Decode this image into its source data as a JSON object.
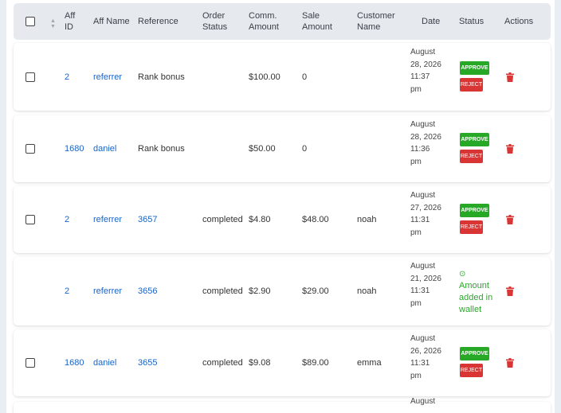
{
  "header": {
    "aff_id": "Aff\nID",
    "aff_name": "Aff Name",
    "reference": "Reference",
    "order_status": "Order\nStatus",
    "comm_amount": "Comm.\nAmount",
    "sale_amount": "Sale\nAmount",
    "customer_name": "Customer\nName",
    "date": "Date",
    "status": "Status",
    "actions": "Actions"
  },
  "labels": {
    "approve": "APPROVE",
    "reject": "REJECT",
    "amount_added": "Amount added in wallet"
  },
  "colors": {
    "approve": "#27a827",
    "reject": "#d93535",
    "link": "#1a64c8",
    "added": "#28a828"
  },
  "rows": [
    {
      "aff_id": "2",
      "aff_name": "referrer",
      "reference": "Rank bonus",
      "order_status": "",
      "comm_amount": "$100.00",
      "sale_amount": "0",
      "customer": "",
      "date": "August 28, 2026 11:37 pm",
      "status": "pending"
    },
    {
      "aff_id": "1680",
      "aff_name": "daniel",
      "reference": "Rank bonus",
      "order_status": "",
      "comm_amount": "$50.00",
      "sale_amount": "0",
      "customer": "",
      "date": "August 28, 2026 11:36 pm",
      "status": "pending"
    },
    {
      "aff_id": "2",
      "aff_name": "referrer",
      "reference": "3657",
      "order_status": "completed",
      "comm_amount": "$4.80",
      "sale_amount": "$48.00",
      "customer": "noah",
      "date": "August 27, 2026 11:31 pm",
      "status": "pending"
    },
    {
      "aff_id": "2",
      "aff_name": "referrer",
      "reference": "3656",
      "order_status": "completed",
      "comm_amount": "$2.90",
      "sale_amount": "$29.00",
      "customer": "noah",
      "date": "August 21, 2026 11:31 pm",
      "status": "added"
    },
    {
      "aff_id": "1680",
      "aff_name": "daniel",
      "reference": "3655",
      "order_status": "completed",
      "comm_amount": "$9.08",
      "sale_amount": "$89.00",
      "customer": "emma",
      "date": "August 26, 2026 11:31 pm",
      "status": "pending"
    },
    {
      "aff_id": "",
      "aff_name": "",
      "reference": "",
      "order_status": "",
      "comm_amount": "",
      "sale_amount": "",
      "customer": "",
      "date": "August",
      "status": "partial"
    }
  ]
}
